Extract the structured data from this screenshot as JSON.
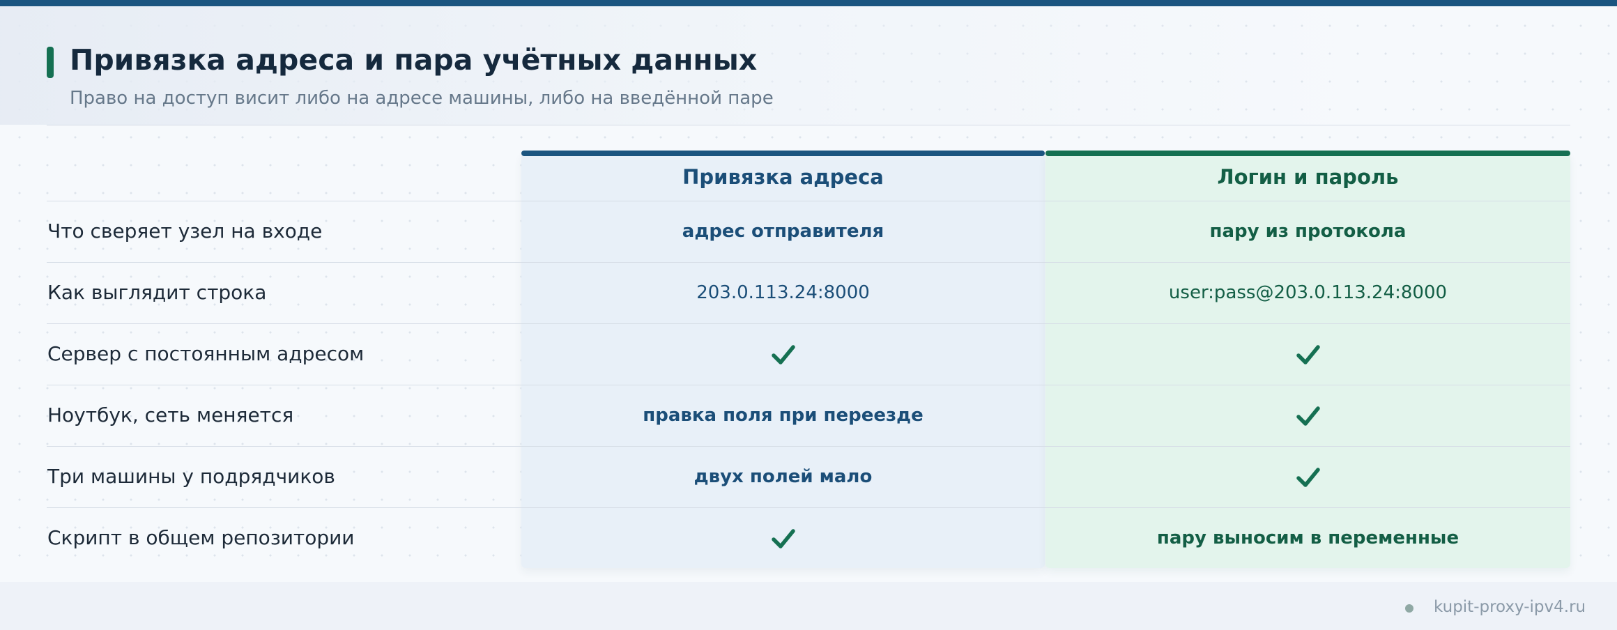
{
  "header": {
    "title": "Привязка адреса и пара учётных данных",
    "subtitle": "Право на доступ висит либо на адресе машины, либо на введённой паре"
  },
  "columns": {
    "a": {
      "title": "Привязка адреса",
      "color": "#1b5580"
    },
    "b": {
      "title": "Логин и пароль",
      "color": "#157052"
    }
  },
  "rows": [
    {
      "label": "Что сверяет узел на входе",
      "a": "адрес отправителя",
      "b": "пару из протокола"
    },
    {
      "label": "Как выглядит строка",
      "a": "203.0.113.24:8000",
      "b": "user:pass@203.0.113.24:8000"
    },
    {
      "label": "Сервер с постоянным адресом",
      "a": "",
      "a_icon": "check-icon",
      "b": "",
      "b_icon": "check-icon"
    },
    {
      "label": "Ноутбук, сеть меняется",
      "a": "правка поля при переезде",
      "b": "",
      "b_icon": "check-icon"
    },
    {
      "label": "Три машины у подрядчиков",
      "a": "двух полей мало",
      "b": "",
      "b_icon": "check-icon"
    },
    {
      "label": "Скрипт в общем репозитории",
      "a": "",
      "a_icon": "check-icon",
      "b": "пару выносим в переменные"
    }
  ],
  "footer": {
    "site": "kupit-proxy-ipv4.ru"
  }
}
